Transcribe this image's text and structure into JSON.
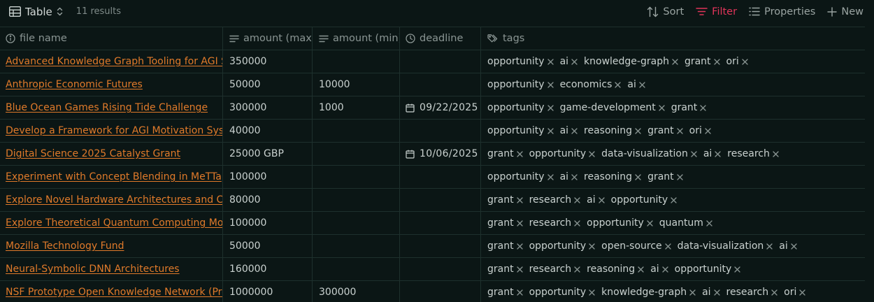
{
  "toolbar": {
    "view_label": "Table",
    "results": "11 results",
    "sort_label": "Sort",
    "filter_label": "Filter",
    "properties_label": "Properties",
    "new_label": "New",
    "filter_color": "#e0345a"
  },
  "columns": {
    "name": "file name",
    "amount_max": "amount (max)",
    "amount_min": "amount (min)",
    "deadline": "deadline",
    "tags": "tags"
  },
  "rows": [
    {
      "name": "Advanced Knowledge Graph Tooling for AGI Systems",
      "max": "350000",
      "min": "",
      "deadline": "",
      "tags": [
        "opportunity",
        "ai",
        "knowledge-graph",
        "grant",
        "ori"
      ]
    },
    {
      "name": "Anthropic Economic Futures",
      "max": "50000",
      "min": "10000",
      "deadline": "",
      "tags": [
        "opportunity",
        "economics",
        "ai"
      ]
    },
    {
      "name": "Blue Ocean Games Rising Tide Challenge",
      "max": "300000",
      "min": "1000",
      "deadline": "09/22/2025",
      "tags": [
        "opportunity",
        "game-development",
        "grant"
      ]
    },
    {
      "name": "Develop a Framework for AGI Motivation Systems",
      "max": "40000",
      "min": "",
      "deadline": "",
      "tags": [
        "opportunity",
        "ai",
        "reasoning",
        "grant",
        "ori"
      ]
    },
    {
      "name": "Digital Science 2025 Catalyst Grant",
      "max": "25000 GBP",
      "min": "",
      "deadline": "10/06/2025",
      "tags": [
        "grant",
        "opportunity",
        "data-visualization",
        "ai",
        "research"
      ]
    },
    {
      "name": "Experiment with Concept Blending in MeTTa",
      "max": "100000",
      "min": "",
      "deadline": "",
      "tags": [
        "opportunity",
        "ai",
        "reasoning",
        "grant"
      ]
    },
    {
      "name": "Explore Novel Hardware Architectures and Computing",
      "max": "80000",
      "min": "",
      "deadline": "",
      "tags": [
        "grant",
        "research",
        "ai",
        "opportunity"
      ]
    },
    {
      "name": "Explore Theoretical Quantum Computing Models",
      "max": "100000",
      "min": "",
      "deadline": "",
      "tags": [
        "grant",
        "research",
        "opportunity",
        "quantum"
      ]
    },
    {
      "name": "Mozilla Technology Fund",
      "max": "50000",
      "min": "",
      "deadline": "",
      "tags": [
        "grant",
        "opportunity",
        "open-source",
        "data-visualization",
        "ai"
      ]
    },
    {
      "name": "Neural-Symbolic DNN Architectures",
      "max": "160000",
      "min": "",
      "deadline": "",
      "tags": [
        "grant",
        "research",
        "reasoning",
        "ai",
        "opportunity"
      ]
    },
    {
      "name": "NSF Prototype Open Knowledge Network (Proto-OKN)",
      "max": "1000000",
      "min": "300000",
      "deadline": "",
      "tags": [
        "grant",
        "opportunity",
        "knowledge-graph",
        "ai",
        "research",
        "ori"
      ]
    }
  ]
}
